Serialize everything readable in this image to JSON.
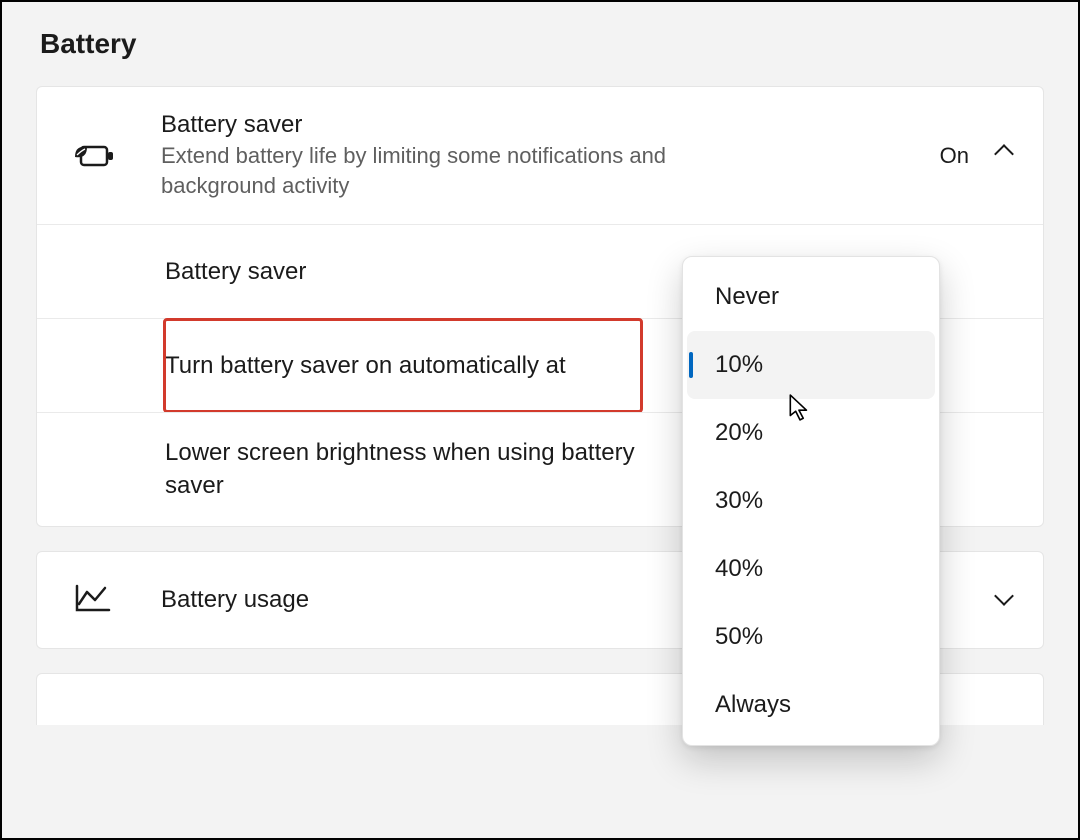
{
  "page": {
    "title": "Battery"
  },
  "saver": {
    "header": {
      "title": "Battery saver",
      "subtitle": "Extend battery life by limiting some notifications and background activity",
      "status": "On",
      "icon": "battery-leaf-icon"
    },
    "rows": {
      "toggle_label": "Battery saver",
      "auto_label": "Turn battery saver on automatically at",
      "brightness_label": "Lower screen brightness when using battery saver"
    }
  },
  "usage": {
    "title": "Battery usage",
    "icon": "line-chart-icon"
  },
  "dropdown": {
    "options": [
      "Never",
      "10%",
      "20%",
      "30%",
      "40%",
      "50%",
      "Always"
    ],
    "selected": "10%"
  },
  "colors": {
    "accent": "#0067c0",
    "highlight": "#d23a2c"
  }
}
